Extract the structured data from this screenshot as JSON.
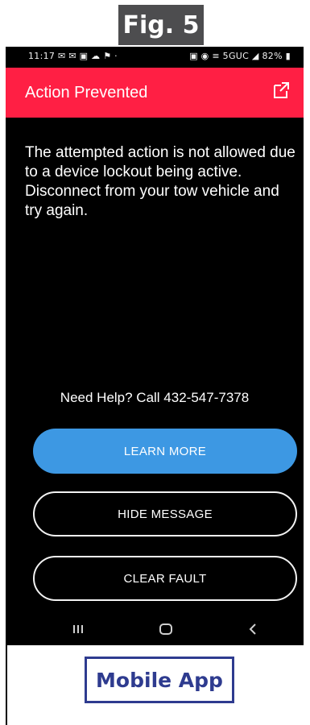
{
  "figure": {
    "label": "Fig. 5",
    "caption": "Mobile App"
  },
  "status_bar": {
    "time": "11:17",
    "left_icons": "✉ ✉ ▣ ☁ ⚑ ·",
    "right_icons": "▣ ◉ ≡ 5GUC ◢ 82% ▮"
  },
  "app_bar": {
    "title": "Action Prevented",
    "external_icon": "external-link-icon",
    "color": "#ff1f44"
  },
  "message": "The attempted action is not allowed due to a device lockout being active. Disconnect from your tow vehicle and try again.",
  "help_text": "Need Help? Call  432-547-7378",
  "buttons": {
    "learn_more": "LEARN MORE",
    "hide_message": "HIDE MESSAGE",
    "clear_fault": "CLEAR FAULT"
  },
  "nav_bar": {
    "recent": "recent-apps-icon",
    "home": "home-icon",
    "back": "back-icon"
  },
  "colors": {
    "primary_button": "#3d98e3",
    "caption": "#2e3b8f",
    "fig_tag": "#4d4d4f"
  }
}
